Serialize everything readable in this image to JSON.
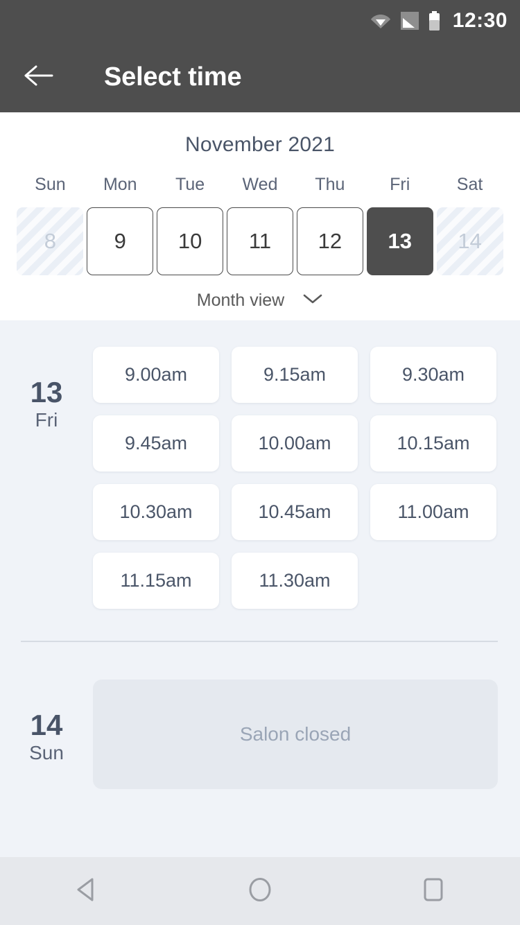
{
  "statusbar": {
    "time": "12:30",
    "icons": [
      "wifi-icon",
      "cell-signal-icon",
      "battery-icon"
    ]
  },
  "appbar": {
    "title": "Select time",
    "back_icon": "back-arrow-icon"
  },
  "calendar": {
    "month_title": "November 2021",
    "weekdays": [
      "Sun",
      "Mon",
      "Tue",
      "Wed",
      "Thu",
      "Fri",
      "Sat"
    ],
    "days": [
      {
        "num": "8",
        "state": "disabled"
      },
      {
        "num": "9",
        "state": "available"
      },
      {
        "num": "10",
        "state": "available"
      },
      {
        "num": "11",
        "state": "available"
      },
      {
        "num": "12",
        "state": "available"
      },
      {
        "num": "13",
        "state": "selected"
      },
      {
        "num": "14",
        "state": "disabled"
      }
    ],
    "month_view_label": "Month view",
    "month_view_icon": "chevron-down-icon"
  },
  "day_groups": [
    {
      "day_num": "13",
      "day_dow": "Fri",
      "slots": [
        "9.00am",
        "9.15am",
        "9.30am",
        "9.45am",
        "10.00am",
        "10.15am",
        "10.30am",
        "10.45am",
        "11.00am",
        "11.15am",
        "11.30am"
      ]
    },
    {
      "day_num": "14",
      "day_dow": "Sun",
      "closed_label": "Salon closed"
    }
  ],
  "navbar": {
    "back_label": "back-triangle-icon",
    "home_label": "home-circle-icon",
    "recents_label": "recents-square-icon"
  },
  "colors": {
    "appbar_bg": "#4e4e4e",
    "page_bg": "#f0f3f8",
    "selected_day_bg": "#4e4e4e",
    "slot_bg": "#ffffff",
    "text_slate": "#4a5568",
    "closed_bg": "#e5e9ef",
    "navbar_bg": "#e6e8ec"
  }
}
